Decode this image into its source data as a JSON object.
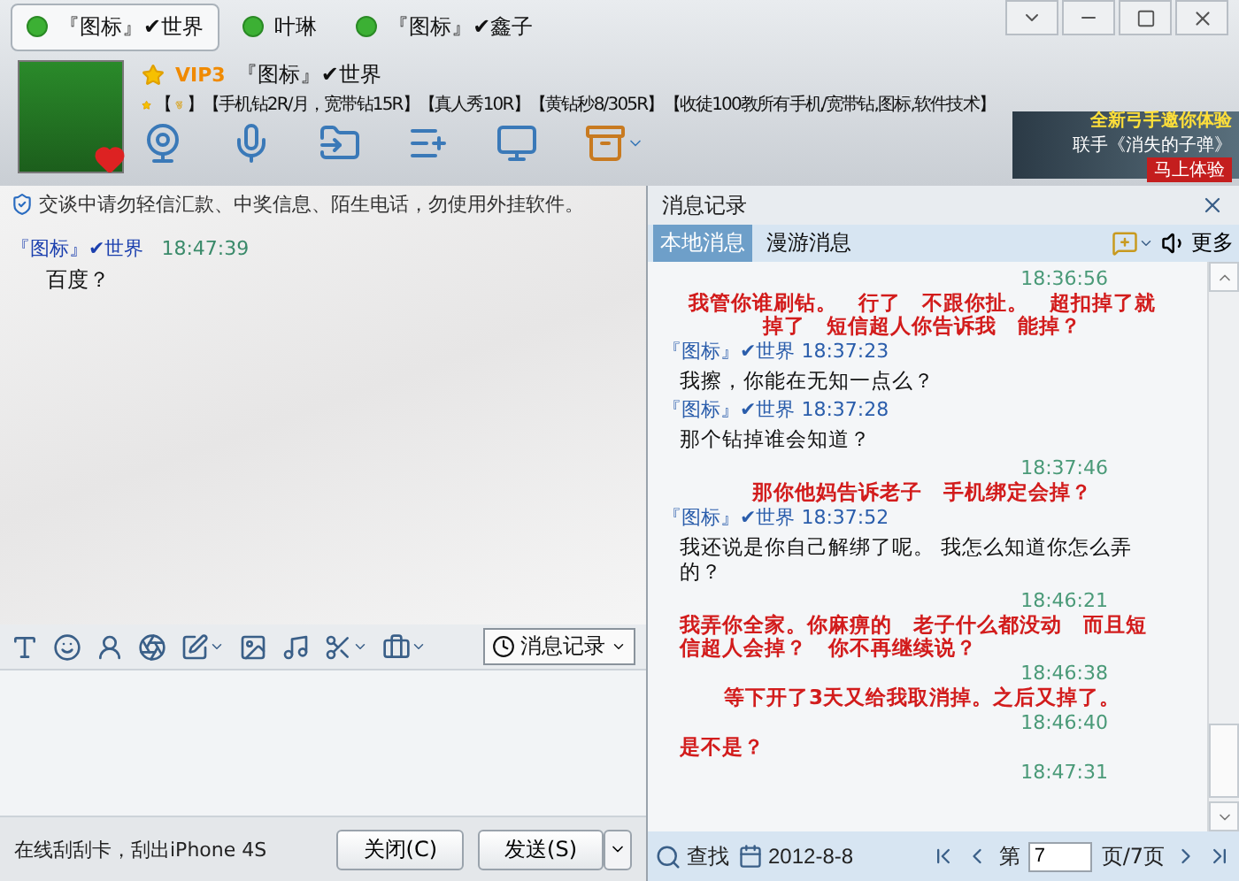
{
  "contact_tabs": [
    {
      "label": "『图标』✔世界",
      "selected": true
    },
    {
      "label": "叶琳",
      "selected": false
    },
    {
      "label": "『图标』✔鑫子",
      "selected": false
    }
  ],
  "profile": {
    "badge": "VIP3",
    "name": "『图标』✔世界",
    "signature": [
      "【",
      "】【手机钻2R/月，宽带钻15R】【真人秀10R】【黄钻秒8/305R】【收徒100教所有手机/宽带钻,图标,软件技术】"
    ]
  },
  "ad_banner": {
    "headline": "全新弓手邀你体验",
    "subline": "联手《消失的子弹》",
    "cta": "马上体验"
  },
  "chat": {
    "notice": "交谈中请勿轻信汇款、中奖信息、陌生电话，勿使用外挂软件。",
    "messages": [
      {
        "sender": "『图标』✔世界",
        "time": "18:47:39",
        "text": "百度？"
      }
    ]
  },
  "compose": {
    "history_button": "消息记录"
  },
  "footer": {
    "promo": "在线刮刮卡，刮出iPhone 4S",
    "close_button": "关闭(C)",
    "send_button": "发送(S)"
  },
  "history": {
    "title": "消息记录",
    "tabs": [
      {
        "label": "本地消息",
        "selected": true
      },
      {
        "label": "漫游消息",
        "selected": false
      }
    ],
    "more": "更多",
    "messages": [
      {
        "kind": "received",
        "time": "18:36:56",
        "text": "我管你谁刷钻。　行了　不跟你扯。　超扣掉了就掉了　短信超人你告诉我　能掉？"
      },
      {
        "kind": "sent",
        "sender": "『图标』✔世界",
        "time": "18:37:23",
        "text": "我擦，你能在无知一点么？"
      },
      {
        "kind": "sent",
        "sender": "『图标』✔世界",
        "time": "18:37:28",
        "text": "那个钻掉谁会知道？"
      },
      {
        "kind": "received",
        "time": "18:37:46",
        "text": "那你他妈告诉老子　手机绑定会掉？"
      },
      {
        "kind": "sent",
        "sender": "『图标』✔世界",
        "time": "18:37:52",
        "text": "我还说是你自己解绑了呢。 我怎么知道你怎么弄的？"
      },
      {
        "kind": "received",
        "time": "18:46:21",
        "text": "我弄你全家。你麻痹的　老子什么都没动　而且短信超人会掉？　你不再继续说？"
      },
      {
        "kind": "received",
        "time": "18:46:38",
        "text": "等下开了3天又给我取消掉。之后又掉了。"
      },
      {
        "kind": "received",
        "time": "18:46:40",
        "text": "是不是？"
      },
      {
        "kind": "received",
        "time": "18:47:31"
      }
    ],
    "search": "查找",
    "date": "2012-8-8",
    "page_label": "第",
    "page": "7",
    "page_total": "页/7页"
  }
}
